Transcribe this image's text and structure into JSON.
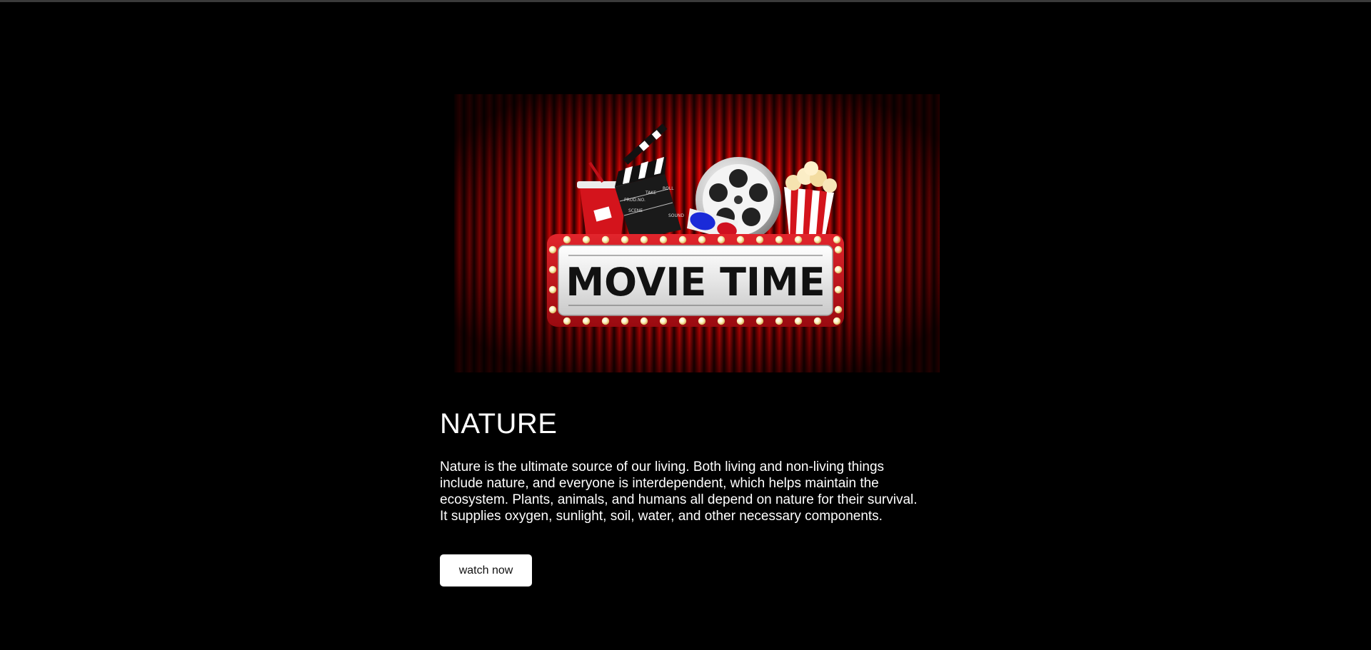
{
  "poster": {
    "marquee_text": "MOVIE TIME",
    "clapper_labels": [
      "PROD.NO.",
      "TAKE",
      "ROLL",
      "SCENE",
      "SOUND"
    ],
    "colors": {
      "curtain": "#b10000",
      "curtain_dark": "#3a0000",
      "frame": "#c8101a",
      "bulb": "#ffe9a8",
      "sign": "#e8e8e8",
      "text": "#111111"
    },
    "icons": [
      "soda-cup-icon",
      "clapperboard-icon",
      "film-reel-icon",
      "3d-glasses-icon",
      "popcorn-icon"
    ]
  },
  "content": {
    "title": "NATURE",
    "description": "Nature is the ultimate source of our living. Both living and non-living things include nature, and everyone is interdependent, which helps maintain the ecosystem. Plants, animals, and humans all depend on nature for their survival. It supplies oxygen, sunlight, soil, water, and other necessary components.",
    "button_label": "watch now"
  }
}
